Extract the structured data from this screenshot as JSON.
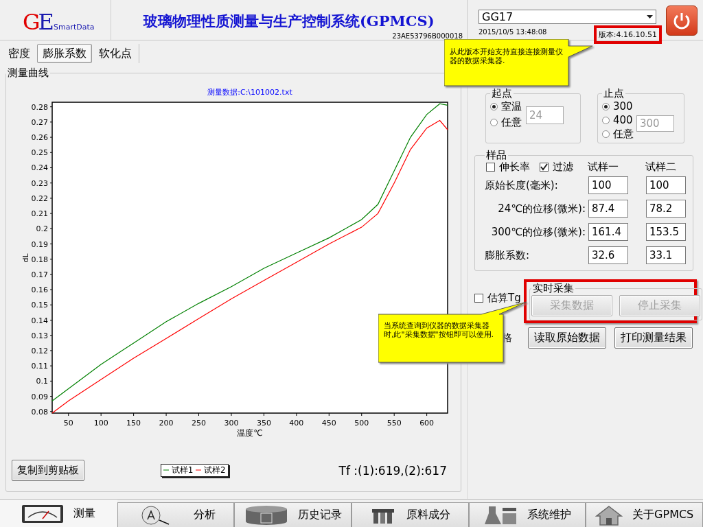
{
  "header": {
    "logo_mark": "GE",
    "logo_text": "SmartData",
    "title": "玻璃物理性质测量与生产控制系统(GPMCS)",
    "serial": "23AE53796B000018",
    "device": "GG17",
    "datetime": "2015/10/5 13:48:08",
    "version": "版本:4.16.10.51",
    "version_highlighted": true
  },
  "tabs": [
    {
      "label": "密度",
      "selected": false
    },
    {
      "label": "膨胀系数",
      "selected": true
    },
    {
      "label": "软化点",
      "selected": false
    }
  ],
  "measurement": {
    "title": "测量曲线",
    "chart_data": {
      "type": "line",
      "title": "测量数据:C:\\101002.txt",
      "xlabel": "温度℃",
      "ylabel": "dL",
      "x": [
        25,
        50,
        100,
        150,
        200,
        250,
        300,
        350,
        400,
        450,
        500,
        525,
        550,
        575,
        600,
        620,
        632
      ],
      "series": [
        {
          "name": "试样1",
          "color": "#008000",
          "values": [
            0.087,
            0.095,
            0.111,
            0.125,
            0.139,
            0.151,
            0.162,
            0.174,
            0.184,
            0.194,
            0.206,
            0.216,
            0.238,
            0.26,
            0.275,
            0.282,
            0.281
          ]
        },
        {
          "name": "试样2",
          "color": "#ff0000",
          "values": [
            0.079,
            0.087,
            0.101,
            0.115,
            0.128,
            0.141,
            0.154,
            0.166,
            0.178,
            0.19,
            0.201,
            0.21,
            0.23,
            0.252,
            0.266,
            0.271,
            0.265
          ]
        }
      ],
      "xlim": [
        25,
        632
      ],
      "ylim": [
        0.079,
        0.283
      ],
      "xticks": [
        50,
        100,
        150,
        200,
        250,
        300,
        350,
        400,
        450,
        500,
        550,
        600
      ],
      "yticks": [
        0.08,
        0.09,
        0.1,
        0.11,
        0.12,
        0.13,
        0.14,
        0.15,
        0.16,
        0.17,
        0.18,
        0.19,
        0.2,
        0.21,
        0.22,
        0.23,
        0.24,
        0.25,
        0.26,
        0.27,
        0.28
      ]
    },
    "copy_button": "复制到剪贴板",
    "tf_result": "Tf :(1):619,(2):617"
  },
  "start_point": {
    "title": "起点",
    "options": [
      {
        "label": "室温",
        "selected": true
      },
      {
        "label": "任意",
        "selected": false
      }
    ],
    "value": "24"
  },
  "end_point": {
    "title": "止点",
    "options": [
      {
        "label": "300",
        "selected": true
      },
      {
        "label": "400",
        "selected": false
      },
      {
        "label": "任意",
        "selected": false
      }
    ],
    "value": "300"
  },
  "sample": {
    "title": "样品",
    "checkboxes": [
      {
        "label": "伸长率",
        "checked": false
      },
      {
        "label": "过滤",
        "checked": true
      }
    ],
    "columns": [
      "试样一",
      "试样二"
    ],
    "rows": [
      {
        "label": "原始长度(毫米):",
        "values": [
          "100",
          "100"
        ]
      },
      {
        "label": "24℃的位移(微米):",
        "values": [
          "87.4",
          "78.2"
        ]
      },
      {
        "label": "300℃的位移(微米):",
        "values": [
          "161.4",
          "153.5"
        ]
      },
      {
        "label": "膨胀系数:",
        "values": [
          "32.6",
          "33.1"
        ]
      }
    ]
  },
  "estimate_tg": {
    "label": "估算Tg",
    "checked": false
  },
  "partial_label": "格",
  "realtime": {
    "title": "实时采集",
    "highlighted": true,
    "buttons": [
      {
        "label": "采集数据",
        "disabled": true
      },
      {
        "label": "停止采集",
        "disabled": true
      }
    ]
  },
  "actions": [
    "读取原始数据",
    "打印测量结果"
  ],
  "callouts": [
    "从此版本开始支持直接连接测量仪器的数据采集器.",
    "当系统查询到仪器的数据采集器时,此\"采集数据\"按钮即可以使用."
  ],
  "bottom_tabs": [
    {
      "label": "测量",
      "selected": true
    },
    {
      "label": "分析",
      "selected": false
    },
    {
      "label": "历史记录",
      "selected": false
    },
    {
      "label": "原料成分",
      "selected": false
    },
    {
      "label": "系统维护",
      "selected": false
    },
    {
      "label": "关于GPMCS",
      "selected": false
    }
  ]
}
